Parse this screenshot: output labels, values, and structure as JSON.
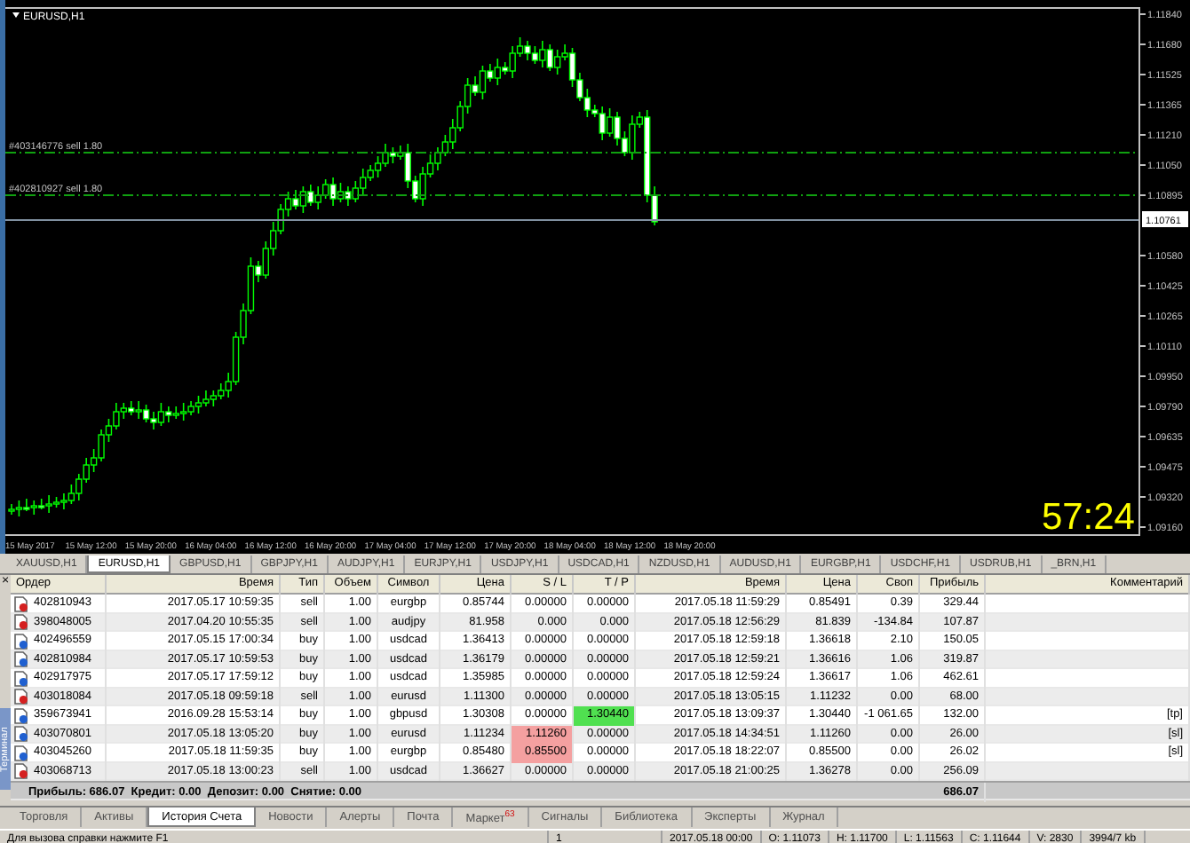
{
  "chart": {
    "title": "EURUSD,H1",
    "price_labels": [
      "1.11840",
      "1.11680",
      "1.11525",
      "1.11365",
      "1.11210",
      "1.11050",
      "1.10895",
      "1.10580",
      "1.10425",
      "1.10265",
      "1.10110",
      "1.09950",
      "1.09790",
      "1.09635",
      "1.09475",
      "1.09320",
      "1.09160"
    ],
    "current_price": "1.10761",
    "order_lines": [
      {
        "label": "#403146776 sell 1.80"
      },
      {
        "label": "#402810927 sell 1.80"
      }
    ],
    "time_labels": [
      "15 May 2017",
      "15 May 12:00",
      "15 May 20:00",
      "16 May 04:00",
      "16 May 12:00",
      "16 May 20:00",
      "17 May 04:00",
      "17 May 12:00",
      "17 May 20:00",
      "18 May 04:00",
      "18 May 12:00",
      "18 May 20:00"
    ],
    "countdown": "57:24"
  },
  "chart_tabs": [
    {
      "label": "XAUUSD,H1",
      "selected": false
    },
    {
      "label": "EURUSD,H1",
      "selected": true
    },
    {
      "label": "GBPUSD,H1",
      "selected": false
    },
    {
      "label": "GBPJPY,H1",
      "selected": false
    },
    {
      "label": "AUDJPY,H1",
      "selected": false
    },
    {
      "label": "EURJPY,H1",
      "selected": false
    },
    {
      "label": "USDJPY,H1",
      "selected": false
    },
    {
      "label": "USDCAD,H1",
      "selected": false
    },
    {
      "label": "NZDUSD,H1",
      "selected": false
    },
    {
      "label": "AUDUSD,H1",
      "selected": false
    },
    {
      "label": "EURGBP,H1",
      "selected": false
    },
    {
      "label": "USDCHF,H1",
      "selected": false
    },
    {
      "label": "USDRUB,H1",
      "selected": false
    },
    {
      "label": "_BRN,H1",
      "selected": false
    }
  ],
  "terminal": {
    "close": "×",
    "title": "Терминал",
    "columns": [
      "Ордер",
      "Время",
      "Тип",
      "Объем",
      "Символ",
      "Цена",
      "S / L",
      "T / P",
      "Время",
      "Цена",
      "Своп",
      "Прибыль",
      "Комментарий"
    ],
    "rows": [
      {
        "kind": "sell",
        "order": "402810943",
        "open_time": "2017.05.17 10:59:35",
        "type": "sell",
        "volume": "1.00",
        "symbol": "eurgbp",
        "open_price": "0.85744",
        "sl": "0.00000",
        "tp": "0.00000",
        "close_time": "2017.05.18 11:59:29",
        "close_price": "0.85491",
        "swap": "0.39",
        "profit": "329.44",
        "sl_hit": false,
        "tp_hit": false
      },
      {
        "kind": "sell",
        "order": "398048005",
        "open_time": "2017.04.20 10:55:35",
        "type": "sell",
        "volume": "1.00",
        "symbol": "audjpy",
        "open_price": "81.958",
        "sl": "0.000",
        "tp": "0.000",
        "close_time": "2017.05.18 12:56:29",
        "close_price": "81.839",
        "swap": "-134.84",
        "profit": "107.87",
        "sl_hit": false,
        "tp_hit": false
      },
      {
        "kind": "buy",
        "order": "402496559",
        "open_time": "2017.05.15 17:00:34",
        "type": "buy",
        "volume": "1.00",
        "symbol": "usdcad",
        "open_price": "1.36413",
        "sl": "0.00000",
        "tp": "0.00000",
        "close_time": "2017.05.18 12:59:18",
        "close_price": "1.36618",
        "swap": "2.10",
        "profit": "150.05",
        "sl_hit": false,
        "tp_hit": false
      },
      {
        "kind": "buy",
        "order": "402810984",
        "open_time": "2017.05.17 10:59:53",
        "type": "buy",
        "volume": "1.00",
        "symbol": "usdcad",
        "open_price": "1.36179",
        "sl": "0.00000",
        "tp": "0.00000",
        "close_time": "2017.05.18 12:59:21",
        "close_price": "1.36616",
        "swap": "1.06",
        "profit": "319.87",
        "sl_hit": false,
        "tp_hit": false
      },
      {
        "kind": "buy",
        "order": "402917975",
        "open_time": "2017.05.17 17:59:12",
        "type": "buy",
        "volume": "1.00",
        "symbol": "usdcad",
        "open_price": "1.35985",
        "sl": "0.00000",
        "tp": "0.00000",
        "close_time": "2017.05.18 12:59:24",
        "close_price": "1.36617",
        "swap": "1.06",
        "profit": "462.61",
        "sl_hit": false,
        "tp_hit": false
      },
      {
        "kind": "sell",
        "order": "403018084",
        "open_time": "2017.05.18 09:59:18",
        "type": "sell",
        "volume": "1.00",
        "symbol": "eurusd",
        "open_price": "1.11300",
        "sl": "0.00000",
        "tp": "0.00000",
        "close_time": "2017.05.18 13:05:15",
        "close_price": "1.11232",
        "swap": "0.00",
        "profit": "68.00",
        "sl_hit": false,
        "tp_hit": false
      },
      {
        "kind": "buy",
        "order": "359673941",
        "open_time": "2016.09.28 15:53:14",
        "type": "buy",
        "volume": "1.00",
        "symbol": "gbpusd",
        "open_price": "1.30308",
        "sl": "0.00000",
        "tp": "1.30440",
        "close_time": "2017.05.18 13:09:37",
        "close_price": "1.30440",
        "swap": "-1 061.65",
        "profit": "132.00",
        "comment": "[tp]",
        "sl_hit": false,
        "tp_hit": true
      },
      {
        "kind": "buy",
        "order": "403070801",
        "open_time": "2017.05.18 13:05:20",
        "type": "buy",
        "volume": "1.00",
        "symbol": "eurusd",
        "open_price": "1.11234",
        "sl": "1.11260",
        "tp": "0.00000",
        "close_time": "2017.05.18 14:34:51",
        "close_price": "1.11260",
        "swap": "0.00",
        "profit": "26.00",
        "comment": "[sl]",
        "sl_hit": true,
        "tp_hit": false
      },
      {
        "kind": "buy",
        "order": "403045260",
        "open_time": "2017.05.18 11:59:35",
        "type": "buy",
        "volume": "1.00",
        "symbol": "eurgbp",
        "open_price": "0.85480",
        "sl": "0.85500",
        "tp": "0.00000",
        "close_time": "2017.05.18 18:22:07",
        "close_price": "0.85500",
        "swap": "0.00",
        "profit": "26.02",
        "comment": "[sl]",
        "sl_hit": true,
        "tp_hit": false
      },
      {
        "kind": "sell",
        "order": "403068713",
        "open_time": "2017.05.18 13:00:23",
        "type": "sell",
        "volume": "1.00",
        "symbol": "usdcad",
        "open_price": "1.36627",
        "sl": "0.00000",
        "tp": "0.00000",
        "close_time": "2017.05.18 21:00:25",
        "close_price": "1.36278",
        "swap": "0.00",
        "profit": "256.09",
        "sl_hit": false,
        "tp_hit": false
      }
    ],
    "summary": {
      "text": "Прибыль: 686.07  Кредит: 0.00  Депозит: 0.00  Снятие: 0.00",
      "profit": "686.07"
    },
    "tabs": [
      {
        "label": "Торговля",
        "selected": false
      },
      {
        "label": "Активы",
        "selected": false
      },
      {
        "label": "История Счета",
        "selected": true
      },
      {
        "label": "Новости",
        "selected": false
      },
      {
        "label": "Алерты",
        "selected": false
      },
      {
        "label": "Почта",
        "selected": false
      },
      {
        "label": "Маркет",
        "badge": "63",
        "selected": false
      },
      {
        "label": "Сигналы",
        "selected": false
      },
      {
        "label": "Библиотека",
        "selected": false
      },
      {
        "label": "Эксперты",
        "selected": false
      },
      {
        "label": "Журнал",
        "selected": false
      }
    ]
  },
  "status_bar": [
    "Для вызова справки нажмите F1",
    "1",
    "2017.05.18 00:00",
    "O: 1.11073",
    "H: 1.11700",
    "L: 1.11563",
    "C: 1.11644",
    "V: 2830",
    "3994/7 kb"
  ]
}
